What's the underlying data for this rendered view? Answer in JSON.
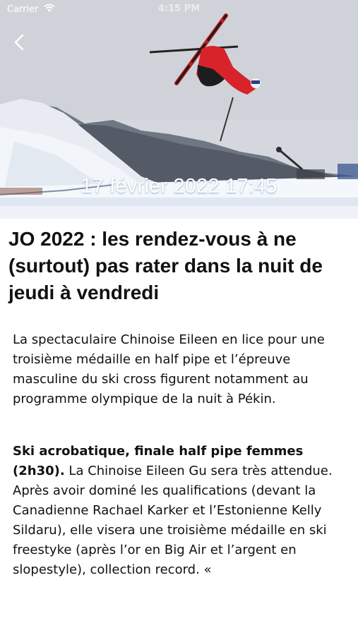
{
  "status_bar": {
    "carrier": "Carrier",
    "time": "4:15 PM"
  },
  "hero": {
    "date": "17 février 2022 17:45",
    "back_icon": "chevron-left-icon"
  },
  "article": {
    "title": "JO 2022 : les rendez-vous à ne (surtout) pas rater dans la nuit de jeudi à vendredi",
    "lead": "La spectaculaire Chinoise Eileen en lice pour une troisième médaille en half pipe et l’épreuve masculine du ski cross figurent notamment au programme olympique de la nuit à Pékin.",
    "section_heading": "Ski acrobatique, finale half pipe femmes (2h30).",
    "section_body": " La Chinoise Eileen Gu sera très attendue. Après avoir dominé les qualifications (devant la Canadienne Rachael Karker et l’Estonienne Kelly Sildaru), elle visera une troisième médaille en ski freestyke (après l’or en Big Air et l’argent en slopestyle), collection record. «"
  },
  "colors": {
    "text": "#111111",
    "hero_overlay_text": "#ffffff"
  }
}
